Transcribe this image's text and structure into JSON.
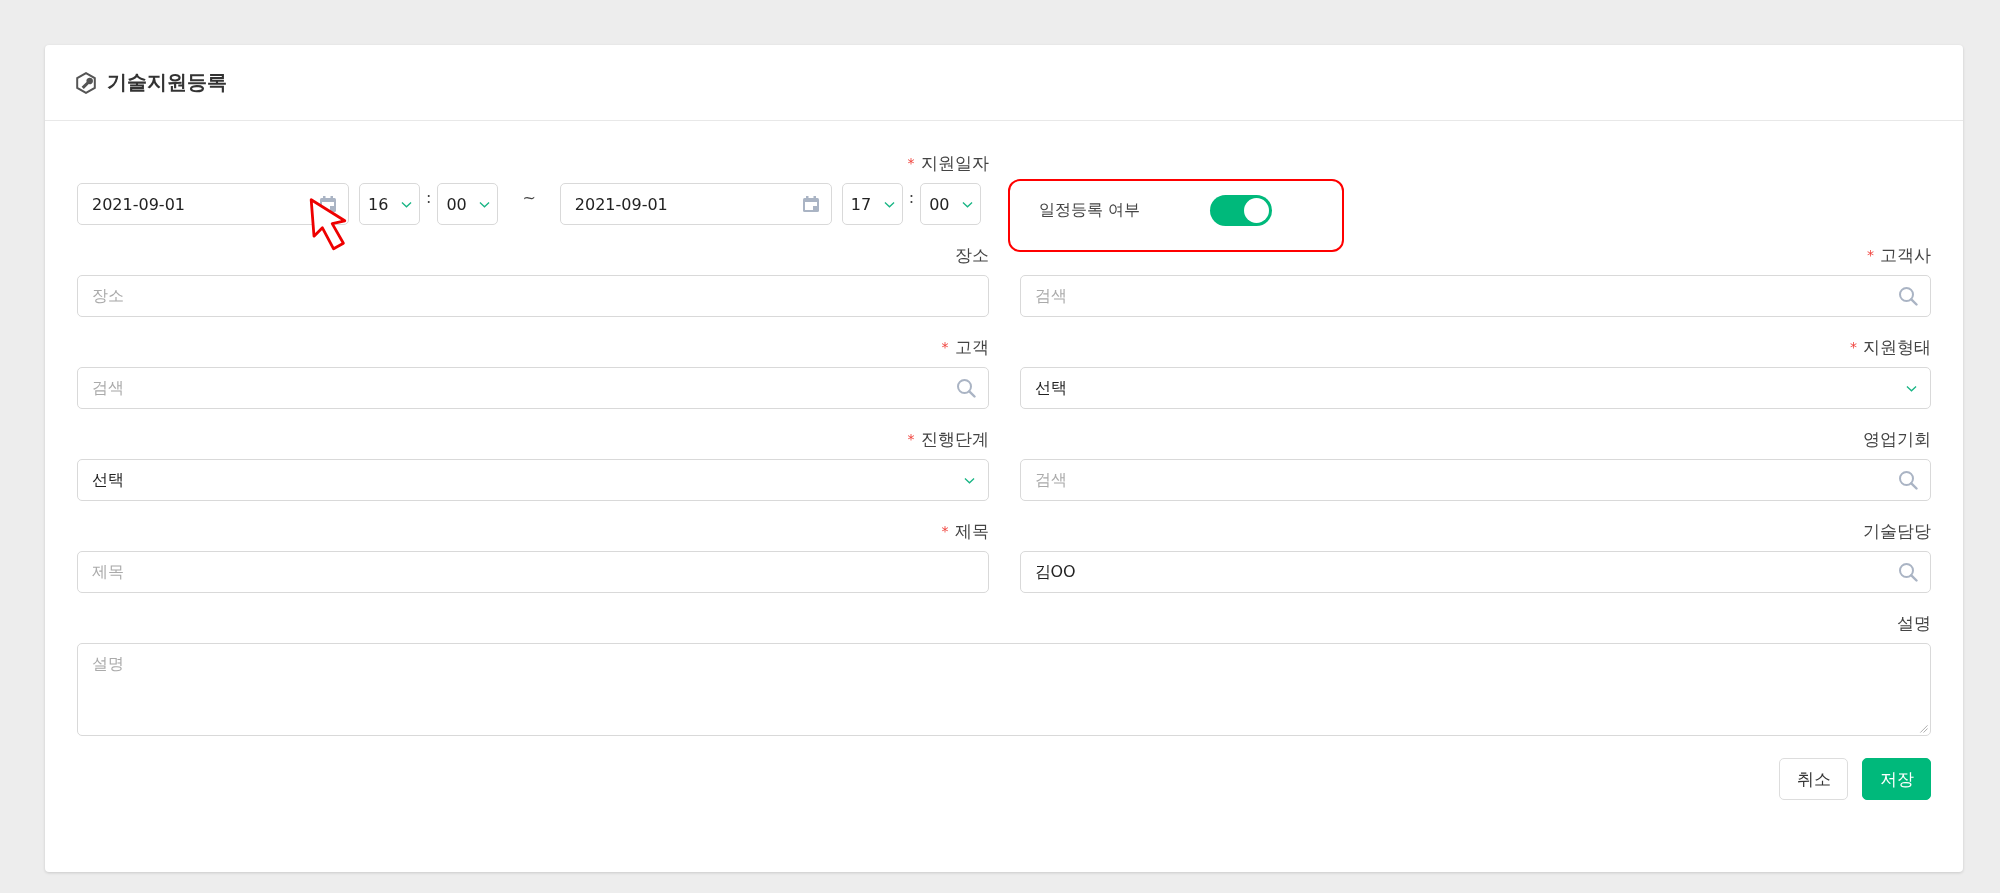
{
  "title": "기술지원등록",
  "required_mark": "*",
  "date_range": {
    "label": "지원일자",
    "required": true,
    "separator": "~",
    "start": {
      "date": "2021-09-01",
      "hour": "16",
      "colon": ":",
      "minute": "00"
    },
    "end": {
      "date": "2021-09-01",
      "hour": "17",
      "colon": ":",
      "minute": "00"
    }
  },
  "schedule_toggle": {
    "label": "일정등록 여부",
    "on": true
  },
  "fields": [
    {
      "kind": "text",
      "label": "장소",
      "required": false,
      "placeholder": "장소"
    },
    {
      "kind": "search",
      "label": "고객사",
      "required": true,
      "placeholder": "검색"
    },
    {
      "kind": "search",
      "label": "고객",
      "required": true,
      "placeholder": "검색"
    },
    {
      "kind": "select",
      "label": "지원형태",
      "required": true,
      "value": "선택"
    },
    {
      "kind": "select",
      "label": "진행단계",
      "required": true,
      "value": "선택"
    },
    {
      "kind": "search",
      "label": "영업기회",
      "required": false,
      "placeholder": "검색"
    },
    {
      "kind": "text",
      "label": "제목",
      "required": true,
      "placeholder": "제목"
    },
    {
      "kind": "search",
      "label": "기술담당",
      "required": false,
      "value": "김OO"
    },
    {
      "kind": "textarea",
      "label": "설명",
      "required": false,
      "placeholder": "설명"
    }
  ],
  "buttons": [
    {
      "kind": "secondary",
      "label": "취소"
    },
    {
      "kind": "primary",
      "label": "저장"
    }
  ]
}
